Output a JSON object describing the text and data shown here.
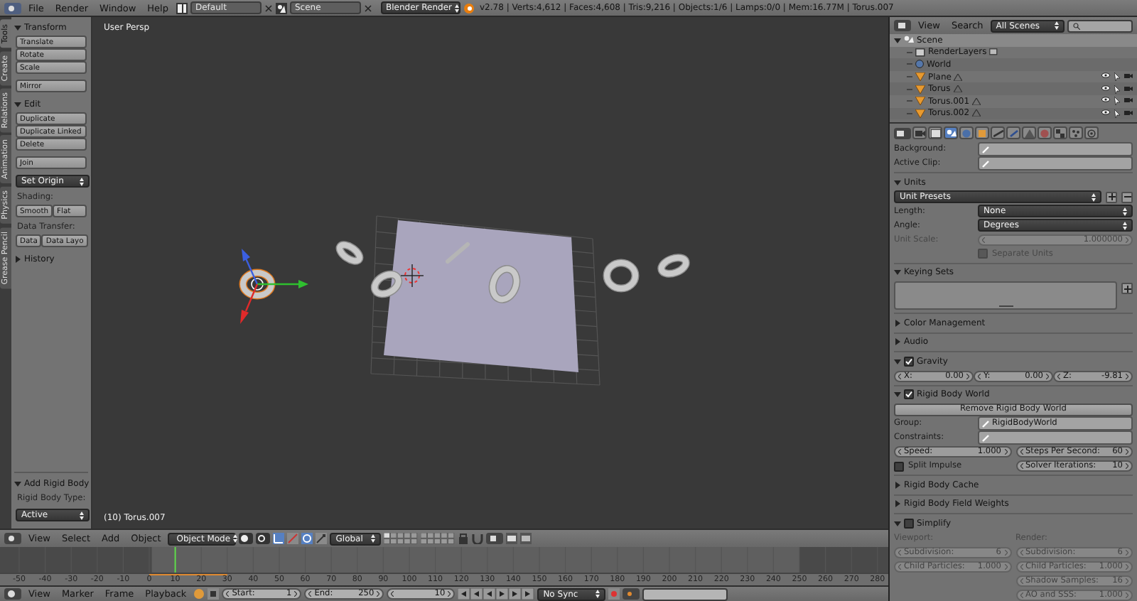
{
  "top_bar": {
    "menus": [
      "File",
      "Render",
      "Window",
      "Help"
    ],
    "layout": "Default",
    "scene": "Scene",
    "engine": "Blender Render",
    "stats": "v2.78 | Verts:4,612 | Faces:4,608 | Tris:9,216 | Objects:1/6 | Lamps:0/0 | Mem:16.77M | Torus.007"
  },
  "tool_tabs": [
    {
      "label": "Tools",
      "selected": true
    },
    {
      "label": "Create",
      "selected": false
    },
    {
      "label": "Relations",
      "selected": false
    },
    {
      "label": "Animation",
      "selected": false
    },
    {
      "label": "Physics",
      "selected": false
    },
    {
      "label": "Grease Pencil",
      "selected": false
    }
  ],
  "tool_panels": [
    {
      "title": "Transform",
      "expanded": true,
      "items": [
        {
          "kind": "column",
          "buttons": [
            "Translate",
            "Rotate",
            "Scale"
          ]
        },
        {
          "kind": "column",
          "buttons": [
            "Mirror"
          ]
        }
      ]
    },
    {
      "title": "Edit",
      "expanded": true,
      "items": [
        {
          "kind": "column",
          "buttons": [
            "Duplicate",
            "Duplicate Linked",
            "Delete"
          ]
        },
        {
          "kind": "column",
          "buttons": [
            "Join"
          ]
        },
        {
          "kind": "dropdown",
          "value": "Set Origin"
        },
        {
          "kind": "label",
          "text": "Shading:"
        },
        {
          "kind": "row",
          "buttons": [
            "Smooth",
            "Flat"
          ]
        },
        {
          "kind": "label",
          "text": "Data Transfer:"
        },
        {
          "kind": "row",
          "buttons": [
            "Data",
            "Data Layo"
          ]
        }
      ]
    },
    {
      "title": "History",
      "expanded": false
    }
  ],
  "operator_panel": {
    "title": "Add Rigid Body",
    "expanded": true,
    "items": [
      {
        "kind": "label",
        "text": "Rigid Body Type:"
      },
      {
        "kind": "dropdown",
        "value": "Active"
      }
    ]
  },
  "viewport": {
    "view_name": "User Persp",
    "object_info": "(10) Torus.007"
  },
  "viewport_header": {
    "menus": [
      "View",
      "Select",
      "Add",
      "Object"
    ],
    "mode": "Object Mode",
    "orientation": "Global"
  },
  "timeline": {
    "ticks": [
      "-50",
      "-40",
      "-30",
      "-20",
      "-10",
      "0",
      "10",
      "20",
      "30",
      "40",
      "50",
      "60",
      "70",
      "80",
      "90",
      "100",
      "110",
      "120",
      "130",
      "140",
      "150",
      "160",
      "170",
      "180",
      "190",
      "200",
      "210",
      "220",
      "230",
      "240",
      "250",
      "260",
      "270",
      "280"
    ]
  },
  "timeline_header": {
    "menus": [
      "View",
      "Marker",
      "Frame",
      "Playback"
    ],
    "start_label": "Start:",
    "start": "1",
    "end_label": "End:",
    "end": "250",
    "current": "10",
    "sync": "No Sync"
  },
  "outliner": {
    "menus": [
      "View",
      "Search"
    ],
    "filter": "All Scenes",
    "tree": [
      {
        "label": "Scene",
        "kind": "scene",
        "selected": true,
        "children": [
          {
            "label": "RenderLayers",
            "kind": "renderlayers",
            "selected": false
          },
          {
            "label": "World",
            "kind": "world",
            "selected": false
          },
          {
            "label": "Plane",
            "kind": "object",
            "selected": false
          },
          {
            "label": "Torus",
            "kind": "object",
            "selected": false
          },
          {
            "label": "Torus.001",
            "kind": "object",
            "selected": false
          },
          {
            "label": "Torus.002",
            "kind": "object",
            "selected": false
          }
        ]
      }
    ]
  },
  "properties": {
    "tabs": [
      {
        "kind": "render",
        "selected": false
      },
      {
        "kind": "layers",
        "selected": false
      },
      {
        "kind": "scene",
        "selected": true
      },
      {
        "kind": "world",
        "selected": false
      },
      {
        "kind": "object",
        "selected": false
      },
      {
        "kind": "constraints",
        "selected": false
      },
      {
        "kind": "modifiers",
        "selected": false
      },
      {
        "kind": "data",
        "selected": false
      },
      {
        "kind": "material",
        "selected": false
      },
      {
        "kind": "texture",
        "selected": false
      },
      {
        "kind": "particles",
        "selected": false
      },
      {
        "kind": "physics",
        "selected": false
      }
    ],
    "sections": [
      {
        "rows": [
          {
            "kind": "field",
            "label": "Background:"
          },
          {
            "kind": "field",
            "label": "Active Clip:"
          }
        ]
      },
      {
        "title": "Units",
        "expanded": true,
        "rows": [
          {
            "kind": "preset",
            "value": "Unit Presets"
          },
          {
            "kind": "dropdown",
            "label": "Length:",
            "value": "None"
          },
          {
            "kind": "dropdown",
            "label": "Angle:",
            "value": "Degrees"
          },
          {
            "kind": "slider",
            "label": "Unit Scale:",
            "value": "1.000000",
            "disabled": true
          },
          {
            "kind": "checkbox",
            "label": "Separate Units",
            "checked": false,
            "disabled": true
          }
        ]
      },
      {
        "title": "Keying Sets",
        "expanded": true,
        "rows": [
          {
            "kind": "list"
          }
        ]
      },
      {
        "title": "Color Management",
        "expanded": false
      },
      {
        "title": "Audio",
        "expanded": false
      },
      {
        "title": "Gravity",
        "expanded": true,
        "checked": true,
        "rows": [
          {
            "kind": "vector",
            "fields": [
              {
                "label": "X:",
                "value": "0.00"
              },
              {
                "label": "Y:",
                "value": "0.00"
              },
              {
                "label": "Z:",
                "value": "-9.81"
              }
            ]
          }
        ]
      },
      {
        "title": "Rigid Body World",
        "expanded": true,
        "checked": true,
        "rows": [
          {
            "kind": "button",
            "label": "Remove Rigid Body World"
          },
          {
            "kind": "field",
            "label": "Group:",
            "value": "RigidBodyWorld"
          },
          {
            "kind": "field",
            "label": "Constraints:"
          },
          {
            "kind": "grid2",
            "cells": [
              {
                "kind": "number",
                "label": "Speed:",
                "value": "1.000",
                "disabled": false
              },
              {
                "kind": "number",
                "label": "Steps Per Second:",
                "value": "60",
                "disabled": false
              }
            ]
          },
          {
            "kind": "grid2",
            "cells": [
              {
                "kind": "checkbox",
                "label": "Split Impulse",
                "checked": false,
                "disabled": false
              },
              {
                "kind": "number",
                "label": "Solver Iterations:",
                "value": "10",
                "disabled": false
              }
            ]
          }
        ]
      },
      {
        "title": "Rigid Body Cache",
        "expanded": false
      },
      {
        "title": "Rigid Body Field Weights",
        "expanded": false
      },
      {
        "title": "Simplify",
        "expanded": true,
        "checked": false,
        "rows": [
          {
            "kind": "grid2",
            "cells": [
              {
                "kind": "heading",
                "label": "Viewport:",
                "disabled": true
              },
              {
                "kind": "heading",
                "label": "Render:",
                "disabled": true
              }
            ]
          },
          {
            "kind": "grid2",
            "cells": [
              {
                "kind": "number",
                "label": "Subdivision:",
                "value": "6",
                "disabled": true
              },
              {
                "kind": "number",
                "label": "Subdivision:",
                "value": "6",
                "disabled": true
              }
            ]
          },
          {
            "kind": "grid2",
            "cells": [
              {
                "kind": "number",
                "label": "Child Particles:",
                "value": "1.000",
                "disabled": true
              },
              {
                "kind": "number",
                "label": "Child Particles:",
                "value": "1.000",
                "disabled": true
              }
            ]
          },
          {
            "kind": "grid2",
            "cells": [
              {
                "kind": "empty"
              },
              {
                "kind": "number",
                "label": "Shadow Samples:",
                "value": "16",
                "disabled": true
              }
            ]
          },
          {
            "kind": "grid2",
            "cells": [
              {
                "kind": "empty"
              },
              {
                "kind": "number",
                "label": "AO and SSS:",
                "value": "1.000",
                "disabled": true
              }
            ]
          }
        ]
      }
    ]
  }
}
